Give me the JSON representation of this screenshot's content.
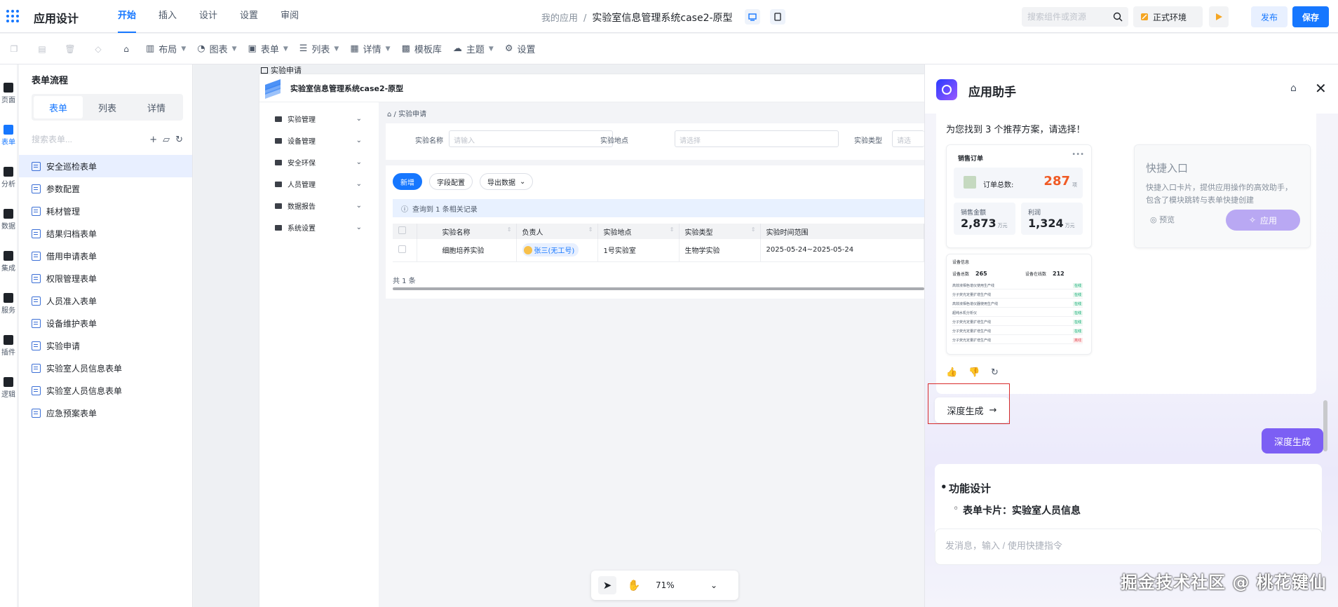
{
  "app": {
    "title": "应用设计"
  },
  "nav_tabs": [
    {
      "label": "开始"
    },
    {
      "label": "插入"
    },
    {
      "label": "设计"
    },
    {
      "label": "设置"
    },
    {
      "label": "审阅"
    }
  ],
  "breadcrumb": {
    "root": "我的应用",
    "sep": "/",
    "project": "实验室信息管理系统case2-原型"
  },
  "header": {
    "search_placeholder": "搜索组件或资源",
    "env_label": "正式环境",
    "publish_label": "发布",
    "save_label": "保存"
  },
  "toolbar": {
    "items": [
      {
        "label": "布局"
      },
      {
        "label": "图表"
      },
      {
        "label": "表单"
      },
      {
        "label": "列表"
      },
      {
        "label": "详情"
      },
      {
        "label": "模板库"
      },
      {
        "label": "主题"
      },
      {
        "label": "设置"
      }
    ]
  },
  "iconbar": [
    {
      "label": "页面"
    },
    {
      "label": "表单"
    },
    {
      "label": "分析"
    },
    {
      "label": "数据"
    },
    {
      "label": "集成"
    },
    {
      "label": "服务"
    },
    {
      "label": "插件"
    },
    {
      "label": "逻辑"
    }
  ],
  "sidebar": {
    "title": "表单流程",
    "tabs": [
      {
        "label": "表单"
      },
      {
        "label": "列表"
      },
      {
        "label": "详情"
      }
    ],
    "search_placeholder": "搜索表单...",
    "items": [
      {
        "label": "安全巡检表单"
      },
      {
        "label": "参数配置"
      },
      {
        "label": "耗材管理"
      },
      {
        "label": "结果归档表单"
      },
      {
        "label": "借用申请表单"
      },
      {
        "label": "权限管理表单"
      },
      {
        "label": "人员准入表单"
      },
      {
        "label": "设备维护表单"
      },
      {
        "label": "实验申请"
      },
      {
        "label": "实验室人员信息表单"
      },
      {
        "label": "实验室人员信息表单"
      },
      {
        "label": "应急预案表单"
      }
    ]
  },
  "canvas": {
    "page_label": "实验申请",
    "proto_title": "实验室信息管理系统case2-原型",
    "nav": [
      {
        "label": "实验管理"
      },
      {
        "label": "设备管理"
      },
      {
        "label": "安全环保"
      },
      {
        "label": "人员管理"
      },
      {
        "label": "数据报告"
      },
      {
        "label": "系统设置"
      }
    ],
    "crumb": "实验申请",
    "filters": [
      {
        "label": "实验名称",
        "placeholder": "请输入"
      },
      {
        "label": "实验地点",
        "placeholder": "请选择"
      },
      {
        "label": "实验类型",
        "placeholder": "请选"
      }
    ],
    "buttons": {
      "add": "新增",
      "fields": "字段配置",
      "export": "导出数据"
    },
    "info": "查询到 1 条相关记录",
    "columns": [
      "实验名称",
      "负责人",
      "实验地点",
      "实验类型",
      "实验时间范围"
    ],
    "rows": [
      {
        "name": "细胞培养实验",
        "owner": "张三(无工号)",
        "place": "1号实验室",
        "type": "生物学实验",
        "range": "2025-05-24~2025-05-24"
      }
    ],
    "total": "共 1 条",
    "zoom": "71%"
  },
  "assistant": {
    "title": "应用助手",
    "intro": "为您找到 3 个推荐方案，请选择！",
    "card1": {
      "title": "销售订单",
      "total_label": "订单总数:",
      "total_value": "287",
      "total_unit": "项",
      "sales_label": "销售金额",
      "sales_value": "2,873",
      "sales_unit": "万元",
      "profit_label": "利润",
      "profit_value": "1,324",
      "profit_unit": "万元"
    },
    "card2": {
      "title": "快捷入口",
      "desc": "快捷入口卡片，提供应用操作的高效助手，包含了模块跳转与表单快捷创建",
      "preview": "预览",
      "apply": "应用"
    },
    "card3": {
      "title": "设备信息",
      "stat1_label": "设备总数",
      "stat1_value": "265",
      "stat2_label": "设备在线数",
      "stat2_value": "212",
      "rows": [
        {
          "name": "高效液相色谱仪使用生产线",
          "tag": "在线"
        },
        {
          "name": "分子荧光定量扩增生产线",
          "tag": "在线"
        },
        {
          "name": "高效液相色谱仪器使用生产线",
          "tag": "在线"
        },
        {
          "name": "超纯水机分析仪",
          "tag": "在线"
        },
        {
          "name": "分子荧光定量扩增生产线",
          "tag": "在线"
        },
        {
          "name": "分子荧光定量扩增生产线",
          "tag": "在线"
        },
        {
          "name": "分子荧光定量扩增生产线",
          "tag": "离线"
        }
      ]
    },
    "deep_card_label": "深度生成",
    "deep_button_label": "深度生成",
    "design_heading": "功能设计",
    "design_sub": "表单卡片：实验室人员信息",
    "input_placeholder": "发消息，输入 / 使用快捷指令"
  },
  "watermark": "掘金技术社区 @ 桃花键仙",
  "colors": {
    "primary": "#1677ff",
    "accent_purple": "#7c5ff4",
    "highlight_red": "#d92b2b"
  }
}
